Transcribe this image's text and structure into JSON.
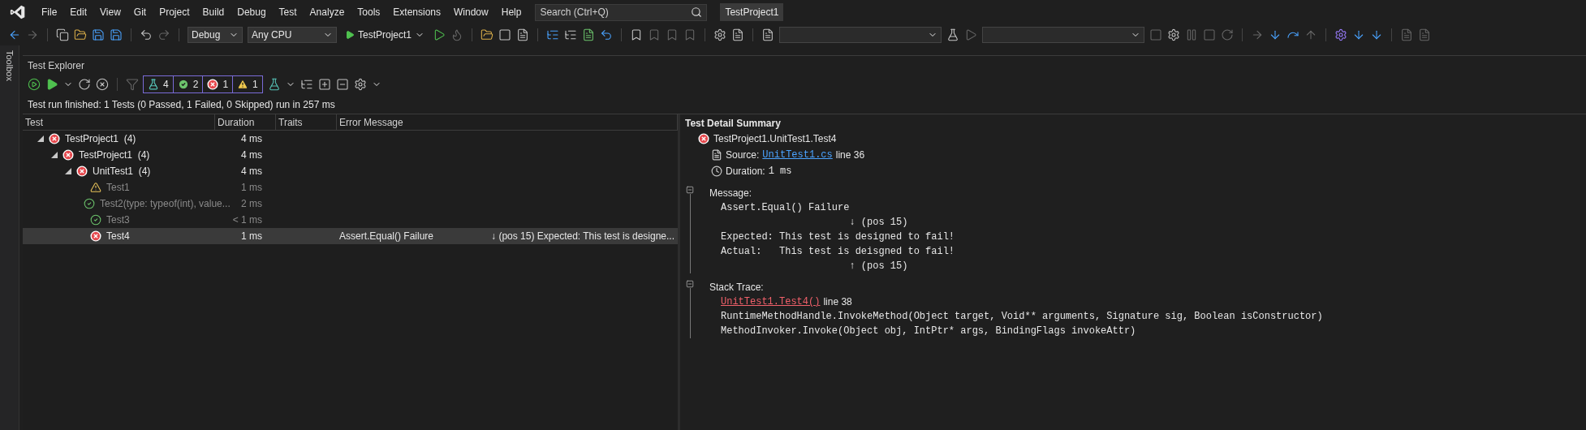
{
  "menu": [
    "File",
    "Edit",
    "View",
    "Git",
    "Project",
    "Build",
    "Debug",
    "Test",
    "Analyze",
    "Tools",
    "Extensions",
    "Window",
    "Help"
  ],
  "search": {
    "placeholder": "Search (Ctrl+Q)"
  },
  "solution_title": "TestProject1",
  "toolbar": {
    "configuration": "Debug",
    "platform": "Any CPU",
    "start_target": "TestProject1"
  },
  "toolbox_tab": "Toolbox",
  "test_explorer": {
    "title": "Test Explorer",
    "counters": [
      {
        "kind": "total",
        "count": "4"
      },
      {
        "kind": "passed",
        "count": "2"
      },
      {
        "kind": "failed",
        "count": "1"
      },
      {
        "kind": "warning",
        "count": "1"
      }
    ],
    "summary": "Test run finished: 1 Tests (0 Passed, 1 Failed, 0 Skipped) run in 257 ms",
    "columns": [
      "Test",
      "Duration",
      "Traits",
      "Error Message"
    ],
    "tree": [
      {
        "label": "TestProject1  (4)",
        "kind": "failed",
        "duration": "4 ms",
        "stale": false,
        "selected": false,
        "expanded": true,
        "children": [
          {
            "label": "TestProject1  (4)",
            "kind": "failed",
            "duration": "4 ms",
            "stale": false,
            "selected": false,
            "expanded": true,
            "children": [
              {
                "label": "UnitTest1  (4)",
                "kind": "failed",
                "duration": "4 ms",
                "stale": false,
                "selected": false,
                "expanded": true,
                "children": [
                  {
                    "label": "Test1",
                    "kind": "warning",
                    "duration": "1 ms",
                    "stale": true,
                    "selected": false
                  },
                  {
                    "label": "Test2(type: typeof(int), value...",
                    "kind": "passed",
                    "duration": "2 ms",
                    "stale": true,
                    "selected": false
                  },
                  {
                    "label": "Test3",
                    "kind": "passed",
                    "duration": "< 1 ms",
                    "stale": true,
                    "selected": false
                  },
                  {
                    "label": "Test4",
                    "kind": "failed",
                    "duration": "1 ms",
                    "stale": false,
                    "selected": true,
                    "error_message": "Assert.Equal() Failure",
                    "error_detail": "↓ (pos 15) Expected: This test is designe..."
                  }
                ]
              }
            ]
          }
        ]
      }
    ]
  },
  "detail": {
    "title": "Test Detail Summary",
    "test_name": "TestProject1.UnitTest1.Test4",
    "kind": "failed",
    "source_label": "Source:",
    "source_link": "UnitTest1.cs",
    "source_line": "line 36",
    "duration_label": "Duration:",
    "duration": "1 ms",
    "message_label": "Message:",
    "message_lines": [
      "Assert.Equal() Failure",
      "                      ↓ (pos 15)",
      "Expected: This test is designed to fail!",
      "Actual:   This test is deisgned to fail!",
      "                      ↑ (pos 15)"
    ],
    "stack_label": "Stack Trace:",
    "stack_link": "UnitTest1.Test4()",
    "stack_link_line": "line 38",
    "stack_lines": [
      "RuntimeMethodHandle.InvokeMethod(Object target, Void** arguments, Signature sig, Boolean isConstructor)",
      "MethodInvoker.Invoke(Object obj, IntPtr* args, BindingFlags invokeAttr)"
    ]
  }
}
